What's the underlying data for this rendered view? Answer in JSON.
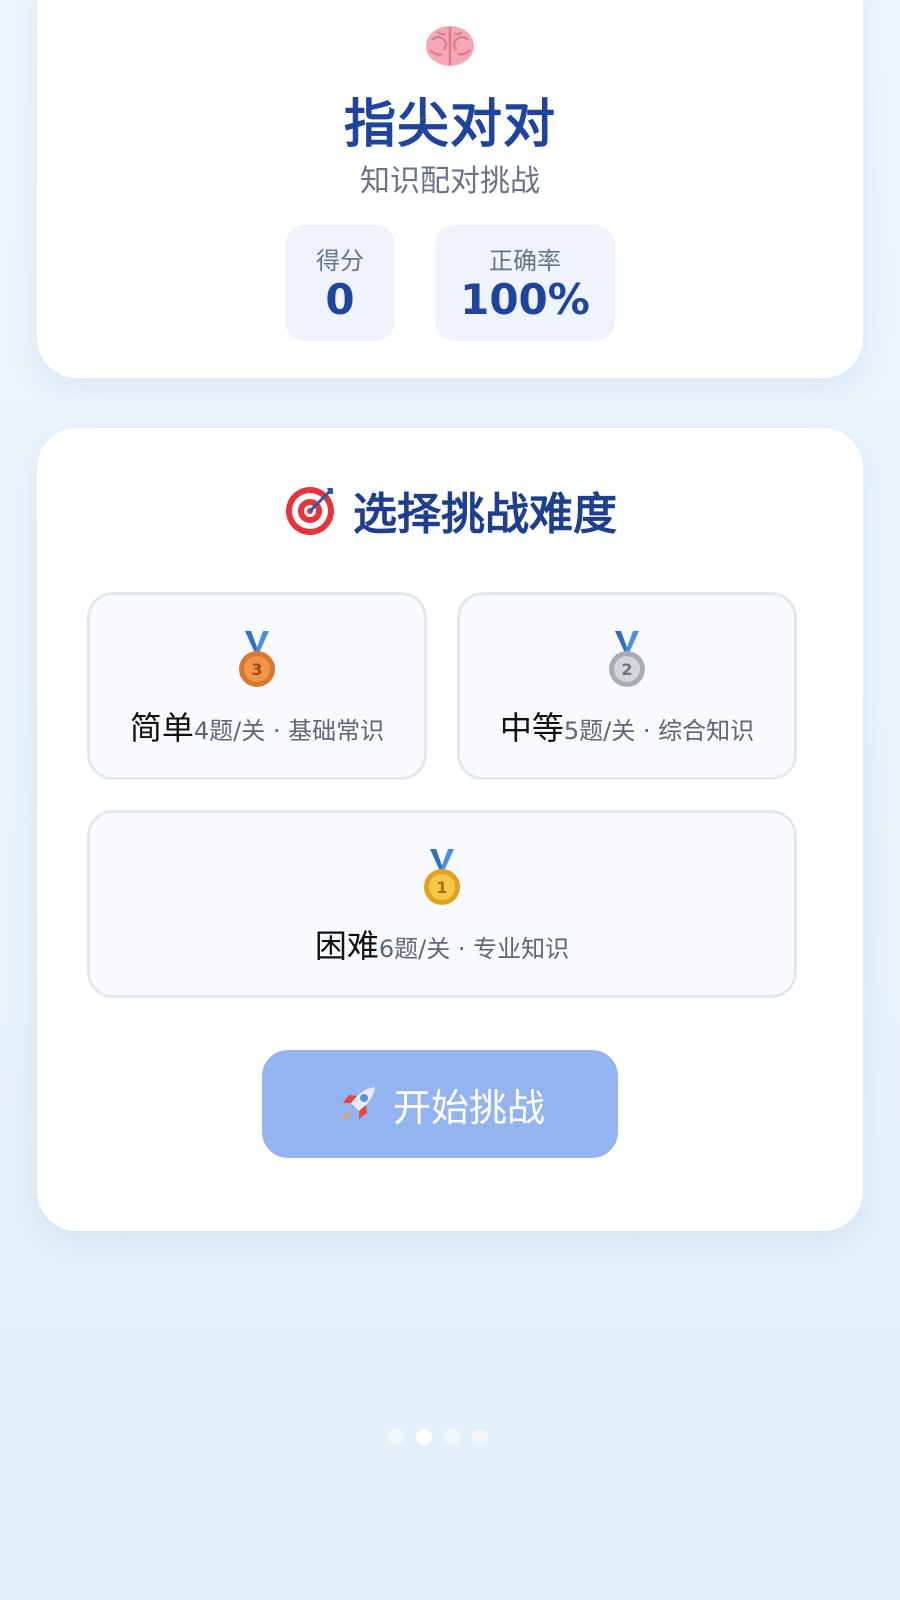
{
  "header": {
    "icon": "brain-icon",
    "title": "指尖对对",
    "subtitle": "知识配对挑战"
  },
  "stats": {
    "score_label": "得分",
    "score_value": "0",
    "accuracy_label": "正确率",
    "accuracy_value": "100%"
  },
  "difficulty": {
    "title_icon": "target-icon",
    "title": "选择挑战难度",
    "levels": [
      {
        "icon": "bronze-medal-icon",
        "name": "简单",
        "desc": "4题/关 · 基础常识"
      },
      {
        "icon": "silver-medal-icon",
        "name": "中等",
        "desc": "5题/关 · 综合知识"
      },
      {
        "icon": "gold-medal-icon",
        "name": "困难",
        "desc": "6题/关 · 专业知识"
      }
    ]
  },
  "start_button": {
    "icon": "rocket-icon",
    "label": "开始挑战"
  },
  "pager": {
    "count": 4,
    "active_index": 1
  },
  "colors": {
    "title_blue": "#1e44a0",
    "button_blue": "#93b4f1",
    "card_bg": "#ffffff",
    "stat_bg": "#eff4fc"
  }
}
